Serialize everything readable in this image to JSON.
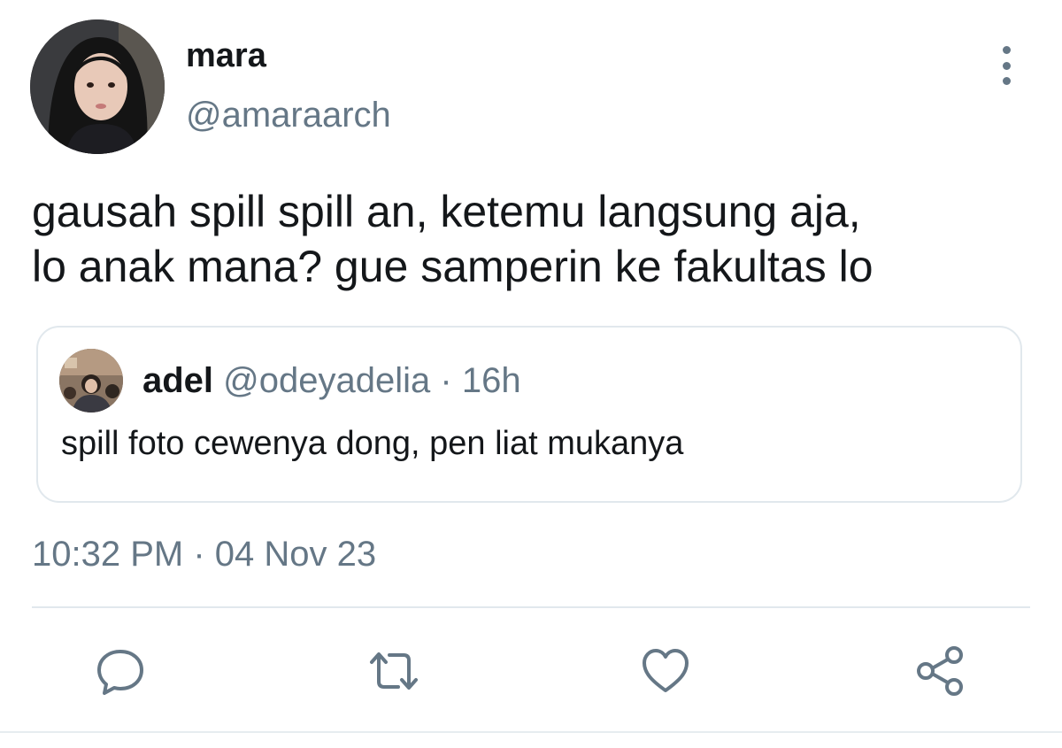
{
  "tweet": {
    "author": {
      "display_name": "mara",
      "handle": "@amaraarch"
    },
    "text": "gausah spill spill an, ketemu langsung aja,\nlo anak mana? gue samperin ke fakultas lo",
    "quoted": {
      "display_name": "adel",
      "handle": "@odeyadelia",
      "separator": "·",
      "time": "16h",
      "text": "spill foto cewenya dong, pen liat mukanya"
    },
    "time": "10:32 PM",
    "separator": "·",
    "date": "04 Nov 23"
  },
  "actions": {
    "icons": [
      "reply-icon",
      "retweet-icon",
      "like-icon",
      "share-icon"
    ],
    "icon_color": "#657786"
  },
  "colors": {
    "text_primary": "#14171a",
    "text_secondary": "#657786",
    "border": "#e1e8ed"
  }
}
